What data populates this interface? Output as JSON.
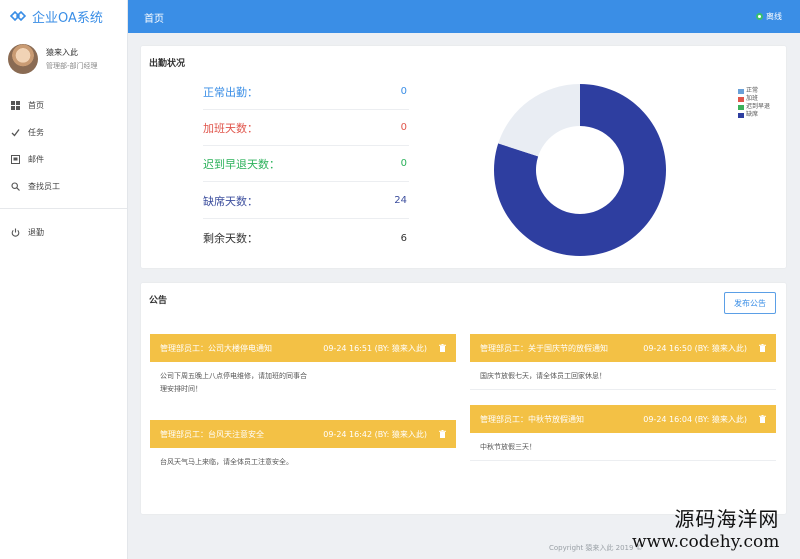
{
  "sidebar": {
    "logo_text": "企业OA系统",
    "user": {
      "name": "猿来入此",
      "role": "管理部-部门经理"
    },
    "menu": [
      {
        "label": "首页",
        "icon": "grid-icon"
      },
      {
        "label": "任务",
        "icon": "check-icon"
      },
      {
        "label": "邮件",
        "icon": "mail-icon"
      },
      {
        "label": "查找员工",
        "icon": "search-icon"
      }
    ],
    "logout": {
      "label": "退勤",
      "icon": "power-icon"
    }
  },
  "header": {
    "title": "首页",
    "status": "离线",
    "status_color": "#39c06b",
    "bar_color": "#3a8ee6"
  },
  "attendance": {
    "title": "出勤状况",
    "rows": [
      {
        "label": "正常出勤：",
        "value": "0",
        "color": "#3a8ee6"
      },
      {
        "label": "加班天数：",
        "value": "0",
        "color": "#e0554b"
      },
      {
        "label": "迟到早退天数：",
        "value": "0",
        "color": "#2bb15a"
      },
      {
        "label": "缺席天数：",
        "value": "24",
        "color": "#2c3e8f"
      },
      {
        "label": "剩余天数：",
        "value": "6",
        "color": "#333333"
      }
    ]
  },
  "chart_data": {
    "type": "pie",
    "categories": [
      "正常",
      "加班",
      "迟到早退",
      "缺席",
      "剩余"
    ],
    "values": [
      0,
      0,
      0,
      24,
      6
    ],
    "colors": [
      "#6aa0d8",
      "#e0554b",
      "#3bb15a",
      "#2e3ea0",
      "#e9edf3"
    ],
    "legend": [
      "正常",
      "加班",
      "迟到早退",
      "缺席"
    ],
    "legend_position": "top-right",
    "donut": true
  },
  "notices": {
    "title": "公告",
    "publish_label": "发布公告",
    "header_color": "#f3c145",
    "items": [
      {
        "title": "管理部员工：公司大楼停电通知",
        "date": "09-24 16:51 (BY: 猿来入此)",
        "body": "公司下周五晚上八点停电维修，请加班的同事合理安排时间！"
      },
      {
        "title": "管理部员工：关于国庆节的放假通知",
        "date": "09-24 16:50 (BY: 猿来入此)",
        "body": "国庆节放假七天，请全体员工回家休息！"
      },
      {
        "title": "管理部员工：台风天注意安全",
        "date": "09-24 16:42 (BY: 猿来入此)",
        "body": "台风天气马上来临，请全体员工注意安全。"
      },
      {
        "title": "管理部员工：中秋节放假通知",
        "date": "09-24 16:04 (BY: 猿来入此)",
        "body": "中秋节放假三天！"
      }
    ]
  },
  "footer": {
    "text": "Copyright 猿来入此 2019 ©"
  },
  "watermark": {
    "line1": "源码海洋网",
    "line2": "www.codehy.com"
  }
}
